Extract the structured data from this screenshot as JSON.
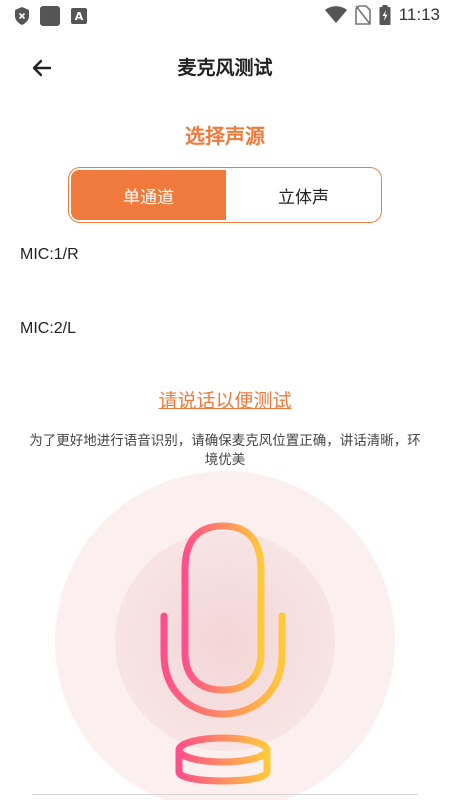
{
  "status_bar": {
    "time": "11:13",
    "icons": [
      "shield-x-icon",
      "app-square-icon",
      "a-badge-icon",
      "wifi-icon",
      "no-sim-icon",
      "battery-charging-icon"
    ]
  },
  "header": {
    "title": "麦克风测试",
    "back_icon": "arrow-left-icon"
  },
  "source": {
    "section_title": "选择声源",
    "options": [
      "单通道",
      "立体声"
    ],
    "selected": "单通道"
  },
  "channels": [
    "MIC:1/R",
    "MIC:2/L"
  ],
  "prompt_link": "请说话以便测试",
  "hint": "为了更好地进行语音识别，请确保麦克风位置正确，讲话清晰，环境优美",
  "colors": {
    "accent": "#F07A3B",
    "gradient_start": "#FF4F8B",
    "gradient_end": "#FFC93B"
  }
}
